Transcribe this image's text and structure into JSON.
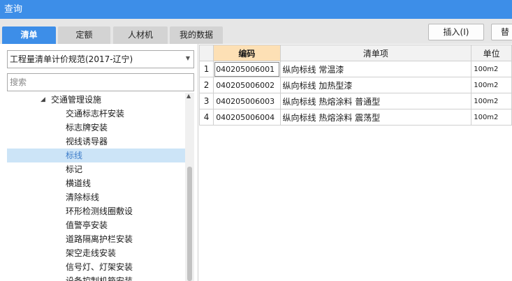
{
  "window": {
    "title": "查询"
  },
  "tabs": [
    {
      "label": "清单",
      "active": true
    },
    {
      "label": "定额"
    },
    {
      "label": "人材机"
    },
    {
      "label": "我的数据"
    }
  ],
  "toolbar": {
    "insert_label": "插入(I)",
    "replace_label": "替"
  },
  "left_panel": {
    "spec_select": "工程量清单计价规范(2017-辽宁)",
    "search_placeholder": "搜索",
    "tree": {
      "parent": {
        "label": "交通管理设施",
        "expander_icon": "collapse-triangle-icon"
      },
      "children": [
        {
          "label": "交通标志杆安装"
        },
        {
          "label": "标志牌安装"
        },
        {
          "label": "视线诱导器"
        },
        {
          "label": "标线",
          "selected": true
        },
        {
          "label": "标记"
        },
        {
          "label": "横道线"
        },
        {
          "label": "清除标线"
        },
        {
          "label": "环形检测线圈敷设"
        },
        {
          "label": "值警亭安装"
        },
        {
          "label": "道路隔离护栏安装"
        },
        {
          "label": "架空走线安装"
        },
        {
          "label": "信号灯、灯架安装"
        },
        {
          "label": "设备控制机箱安装"
        }
      ]
    }
  },
  "grid": {
    "columns": [
      "编码",
      "清单项",
      "单位"
    ],
    "rows": [
      {
        "num": "1",
        "code": "040205006001",
        "item": "纵向标线 常温漆",
        "unit": "100m2"
      },
      {
        "num": "2",
        "code": "040205006002",
        "item": "纵向标线 加热型漆",
        "unit": "100m2"
      },
      {
        "num": "3",
        "code": "040205006003",
        "item": "纵向标线 热熔涂料 普通型",
        "unit": "100m2"
      },
      {
        "num": "4",
        "code": "040205006004",
        "item": "纵向标线 热熔涂料 震荡型",
        "unit": "100m2"
      }
    ]
  },
  "colors": {
    "accent": "#3d8ee8",
    "selected_row": "#cce4f7",
    "active_header": "#fde0b5"
  }
}
